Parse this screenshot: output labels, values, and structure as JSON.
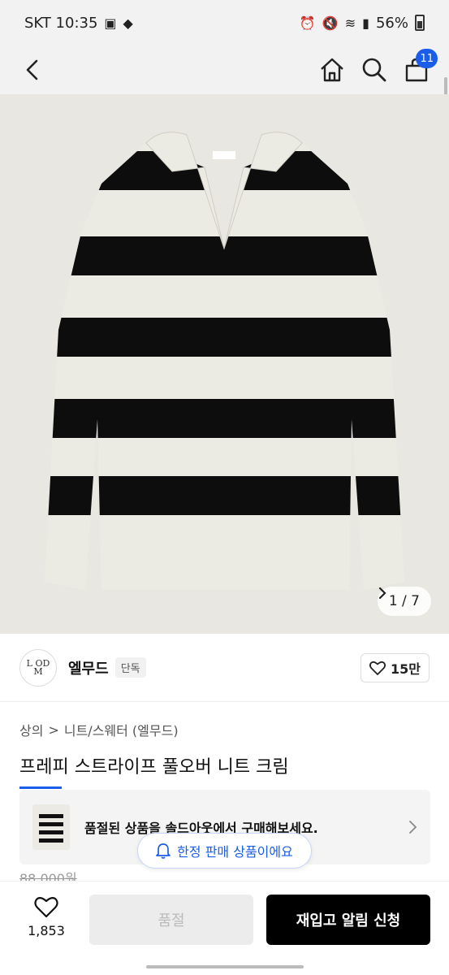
{
  "status_bar": {
    "carrier_time": "SKT 10:35",
    "battery": "56%"
  },
  "header": {
    "back_icon": "chevron-left-icon",
    "home_icon": "home-icon",
    "search_icon": "search-icon",
    "cart_icon": "cart-icon",
    "cart_badge": "11"
  },
  "image_gallery": {
    "counter": "1 / 7",
    "colors": {
      "stripe_dark": "#0d0d0d",
      "stripe_light": "#ecebe3",
      "background": "#e9e7e2"
    }
  },
  "brand": {
    "logo_text_top": "L OD",
    "logo_text_bottom": "M",
    "name": "엘무드",
    "tag": "단독",
    "likes": "15만"
  },
  "breadcrumb": {
    "level1": "상의",
    "separator": ">",
    "level2": "니트/스웨터 (엘무드)"
  },
  "product": {
    "title": "프레피 스트라이프 풀오버 니트 크림",
    "price": "88,000원"
  },
  "soldout_banner": {
    "text": "품절된 상품을 솔드아웃에서 구매해보세요."
  },
  "limited_pill": {
    "text": "한정 판매 상품이에요"
  },
  "bottom_bar": {
    "wish_count": "1,853",
    "soldout_label": "품절",
    "restock_label": "재입고 알림 신청"
  },
  "colors": {
    "accent": "#1a5de8",
    "button_dark": "#000000"
  }
}
